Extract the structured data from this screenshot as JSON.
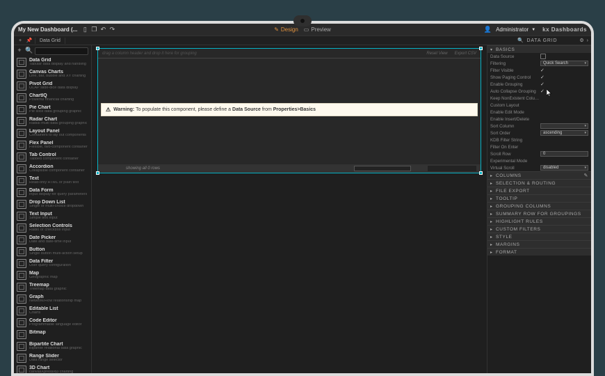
{
  "titlebar": {
    "title": "My New Dashboard (...",
    "icons": [
      "new-doc",
      "copy",
      "undo",
      "redo"
    ],
    "mode_design": "Design",
    "mode_preview": "Preview",
    "user_label": "Administrator",
    "brand": "kx Dashboards"
  },
  "tabstrip": {
    "tab": "Data Grid",
    "right_label": "DATA GRID"
  },
  "search": {
    "placeholder": ""
  },
  "palette": [
    {
      "name": "Data Grid",
      "desc": "Tabular data display and handling"
    },
    {
      "name": "Canvas Charts",
      "desc": "Line, bar, bubble and XY charting"
    },
    {
      "name": "Pivot Grid",
      "desc": "OLAP slide-dice data display"
    },
    {
      "name": "ChartIQ",
      "desc": "Powerful financial charting"
    },
    {
      "name": "Pie Chart",
      "desc": "Pie slice data grouping graphic"
    },
    {
      "name": "Radar Chart",
      "desc": "Radial multi data grouping graphic"
    },
    {
      "name": "Layout Panel",
      "desc": "Containers to lay out components"
    },
    {
      "name": "Flex Panel",
      "desc": "Flexible, two-component container"
    },
    {
      "name": "Tab Control",
      "desc": "Tabbed component container"
    },
    {
      "name": "Accordion",
      "desc": "Collapsible component container"
    },
    {
      "name": "Text",
      "desc": "Read-only HTML or plain text"
    },
    {
      "name": "Data Form",
      "desc": "Input display for query parameters"
    },
    {
      "name": "Drop Down List",
      "desc": "Single or multi-choice dropdown"
    },
    {
      "name": "Text Input",
      "desc": "Simple text input"
    },
    {
      "name": "Selection Controls",
      "desc": "Radio or checkbox input"
    },
    {
      "name": "Date Picker",
      "desc": "Date and date-time input"
    },
    {
      "name": "Button",
      "desc": "Single button multi-action setup"
    },
    {
      "name": "Data Filter",
      "desc": "User query configuration"
    },
    {
      "name": "Map",
      "desc": "Geographic map"
    },
    {
      "name": "Treemap",
      "desc": "Treemap data graphic"
    },
    {
      "name": "Graph",
      "desc": "Network/Flow relationship map"
    },
    {
      "name": "Editable List",
      "desc": "Charts"
    },
    {
      "name": "Code Editor",
      "desc": "Programmable language editor"
    },
    {
      "name": "Bitmap",
      "desc": ""
    },
    {
      "name": "Bipartite Chart",
      "desc": "Bipartite relational data graphic"
    },
    {
      "name": "Range Slider",
      "desc": "Data range selector"
    },
    {
      "name": "3D Chart",
      "desc": "canvasXpress/d3 charting"
    }
  ],
  "canvas": {
    "grouping_placeholder": "drag a column header and drop it here for grouping",
    "header_tool_left": "Reset View",
    "header_tool_right": "Export CSV",
    "warning_label": "Warning:",
    "warning_text": "To populate this component, please define a ",
    "warning_strong": "Data Source",
    "warning_text2": " from ",
    "warning_strong2": "Properties>Basics",
    "footer": "showing all 0 rows"
  },
  "props": {
    "title": "DATA GRID",
    "sections": {
      "basics": "BASICS",
      "columns": "COLUMNS",
      "selection": "SELECTION & ROUTING",
      "file_export": "FILE EXPORT",
      "tooltip": "TOOLTIP",
      "grouping_cols": "GROUPING COLUMNS",
      "summary_row": "SUMMARY ROW FOR GROUPINGS",
      "highlight": "HIGHLIGHT RULES",
      "custom_filters": "CUSTOM FILTERS",
      "style": "STYLE",
      "margins": "MARGINS",
      "format": "FORMAT"
    },
    "basics_rows": {
      "data_source": "Data Source",
      "filtering": "Filtering",
      "filtering_val": "Quick Search",
      "filter_visible": "Filter Visible",
      "show_paging": "Show Paging Control",
      "enable_grouping": "Enable Grouping",
      "auto_collapse": "Auto Collapse Grouping",
      "keep_nonexistent": "Keep NonExistent Columns",
      "custom_layout": "Custom Layout",
      "enable_edit": "Enable Edit Mode",
      "enable_insert_delete": "Enable Insert/Delete",
      "sort_col": "Sort Column",
      "sort_order": "Sort Order",
      "sort_order_val": "ascending",
      "kdb_filter": "KDB Filter String",
      "filter_on_enter": "Filter On Enter",
      "scroll_row": "Scroll Row",
      "scroll_row_val": "0",
      "experimental": "Experimental Mode",
      "virtual_scroll": "Virtual Scroll",
      "virtual_scroll_val": "disabled"
    }
  }
}
